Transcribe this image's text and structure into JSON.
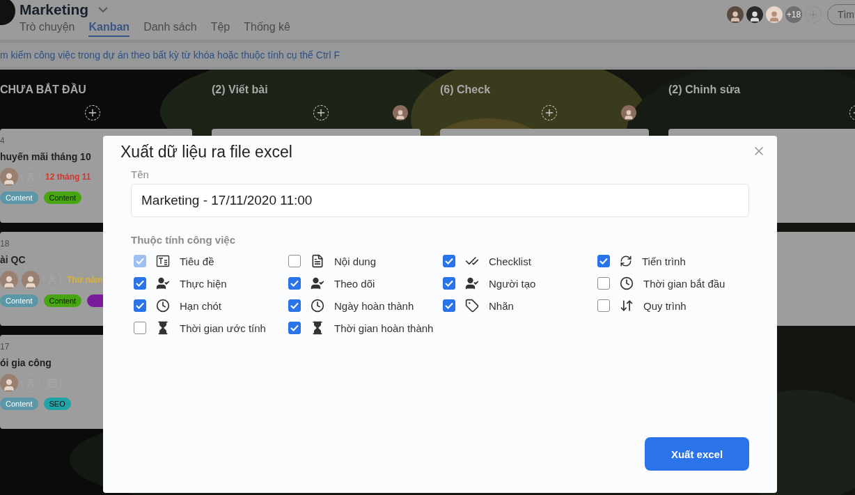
{
  "header": {
    "title": "Marketing",
    "tabs": [
      {
        "label": "Trò chuyện",
        "selected": false
      },
      {
        "label": "Kanban",
        "selected": true
      },
      {
        "label": "Danh sách",
        "selected": false
      },
      {
        "label": "Tệp",
        "selected": false
      },
      {
        "label": "Thống kê",
        "selected": false
      }
    ],
    "member_count": "+18",
    "search_button": "Tìm"
  },
  "search": {
    "placeholder": "m kiếm công việc trong dự án theo bất kỳ từ khóa hoặc thuộc tính cụ thể Ctrl F"
  },
  "columns": [
    {
      "title": "CHƯA BẮT ĐẦU",
      "member_avatar": false,
      "cards": [
        {
          "kind": "task",
          "id": "4",
          "title": "huyến mãi tháng 10",
          "slots": [
            {
              "kind": "avatar"
            },
            {
              "kind": "assignee-slot"
            },
            {
              "kind": "due",
              "text": "12 tháng 11",
              "color": "#d2372a"
            }
          ],
          "tags": [
            {
              "label": "Content",
              "color": "#5b97a6"
            },
            {
              "label": "Content",
              "color": "#46a511"
            }
          ]
        },
        {
          "kind": "task",
          "id": "18",
          "title": "ài QC",
          "slots": [
            {
              "kind": "avatar"
            },
            {
              "kind": "avatar"
            },
            {
              "kind": "assignee-slot"
            },
            {
              "kind": "due",
              "text": "Thứ năm",
              "color": "#d9b23a"
            }
          ],
          "tags": [
            {
              "label": "Content",
              "color": "#5b97a6"
            },
            {
              "label": "Content",
              "color": "#46a511"
            },
            {
              "color": "#7a1b9e"
            }
          ]
        },
        {
          "kind": "task",
          "id": "17",
          "title": "ói gia công",
          "slots": [
            {
              "kind": "avatar"
            },
            {
              "kind": "assignee-slot"
            },
            {
              "kind": "date-slot"
            }
          ],
          "tags": [
            {
              "label": "Content",
              "color": "#5b97a6"
            },
            {
              "label": "SEO",
              "color": "#23a3a5"
            }
          ]
        }
      ]
    },
    {
      "title": "(2) Viết bài",
      "member_avatar": true,
      "cards": [
        {
          "kind": "blank"
        }
      ]
    },
    {
      "title": "(6) Check",
      "member_avatar": true,
      "cards": [
        {
          "kind": "blank"
        }
      ]
    },
    {
      "title": "(2) Chỉnh sửa",
      "member_avatar": false,
      "cards": [
        {
          "kind": "blank"
        },
        {
          "kind": "blank"
        }
      ]
    }
  ],
  "dialog": {
    "title": "Xuất dữ liệu ra file excel",
    "name_label": "Tên",
    "name_value": "Marketing - 17/11/2020 11:00",
    "fields_label": "Thuộc tính công việc",
    "fields": [
      {
        "label": "Tiêu đề",
        "checked": true,
        "disabled": true
      },
      {
        "label": "Nội dung",
        "checked": false,
        "disabled": false
      },
      {
        "label": "Checklist",
        "checked": true,
        "disabled": false
      },
      {
        "label": "Tiến trình",
        "checked": true,
        "disabled": false
      },
      {
        "label": "Thực hiện",
        "checked": true,
        "disabled": false
      },
      {
        "label": "Theo dõi",
        "checked": true,
        "disabled": false
      },
      {
        "label": "Người tạo",
        "checked": true,
        "disabled": false
      },
      {
        "label": "Thời gian bắt đầu",
        "checked": false,
        "disabled": false
      },
      {
        "label": "Hạn chót",
        "checked": true,
        "disabled": false
      },
      {
        "label": "Ngày hoàn thành",
        "checked": true,
        "disabled": false
      },
      {
        "label": "Nhãn",
        "checked": true,
        "disabled": false
      },
      {
        "label": "Quy trình",
        "checked": false,
        "disabled": false
      },
      {
        "label": "Thời gian ước tính",
        "checked": false,
        "disabled": false
      },
      {
        "label": "Thời gian hoàn thành",
        "checked": true,
        "disabled": false
      }
    ],
    "submit": "Xuất excel"
  }
}
